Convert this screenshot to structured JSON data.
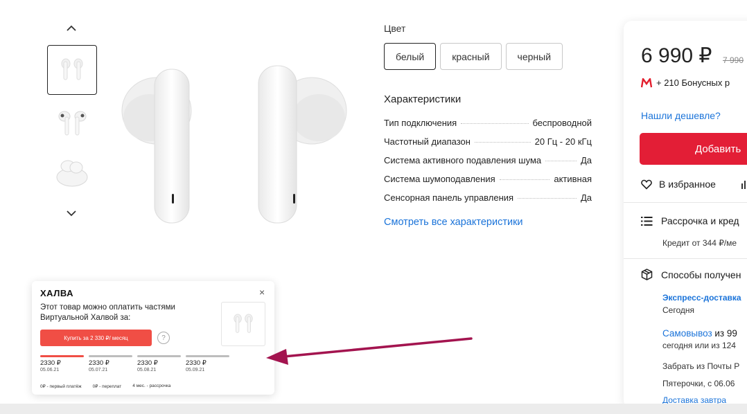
{
  "gallery": {
    "up_icon": "chevron-up-icon",
    "down_icon": "chevron-down-icon",
    "thumbnails": [
      "earbuds-pair",
      "earbuds-angled",
      "earbuds-in-case"
    ]
  },
  "product": {
    "color_label": "Цвет",
    "colors": [
      {
        "label": "белый",
        "selected": true
      },
      {
        "label": "красный",
        "selected": false
      },
      {
        "label": "черный",
        "selected": false
      }
    ],
    "specs_title": "Характеристики",
    "specs": [
      {
        "name": "Тип подключения",
        "value": "беспроводной"
      },
      {
        "name": "Частотный диапазон",
        "value": "20 Гц - 20 кГц"
      },
      {
        "name": "Система активного подавления шума",
        "value": "Да"
      },
      {
        "name": "Система шумоподавления",
        "value": "активная"
      },
      {
        "name": "Сенсорная панель управления",
        "value": "Да"
      }
    ],
    "all_specs_link": "Смотреть все характеристики"
  },
  "buy": {
    "price": "6 990 ₽",
    "old_price": "7 990",
    "bonus_text": "+ 210 Бонусных р",
    "cheaper_link": "Нашли дешевле?",
    "add_label": "Добавить",
    "favorites_label": "В избранное",
    "credit_label": "Рассрочка и кред",
    "credit_sub": "Кредит от 344 ₽/ме",
    "receive_label": "Способы получен",
    "express_title": "Экспресс-доставка",
    "express_when": "Сегодня",
    "pickup_link": "Самовывоз",
    "pickup_rest": " из 99",
    "pickup_line2": "сегодня или из 124",
    "post_line1": "Забрать из Почты Р",
    "post_line2": "Пятерочки, с 06.06",
    "delivery_partial": "Доставка завтра"
  },
  "halva": {
    "logo": "ХАЛВА",
    "close": "×",
    "text": "Этот товар можно оплатить частями Виртуальной Халвой за:",
    "buy_label": "Купить за 2 330 ₽/ месяц",
    "help": "?",
    "payments": [
      {
        "amount": "2330 ₽",
        "date": "05.06.21",
        "current": true
      },
      {
        "amount": "2330 ₽",
        "date": "05.07.21",
        "current": false
      },
      {
        "amount": "2330 ₽",
        "date": "05.08.21",
        "current": false
      },
      {
        "amount": "2330 ₽",
        "date": "05.09.21",
        "current": false
      }
    ],
    "terms": [
      "0₽ - первый платёж",
      "0₽ - переплат",
      "4 мес. - рассрочка"
    ]
  },
  "colors": {
    "accent_red": "#e31e36",
    "link_blue": "#1a73d9",
    "halva_red": "#f04e45",
    "arrow": "#a3144f"
  }
}
